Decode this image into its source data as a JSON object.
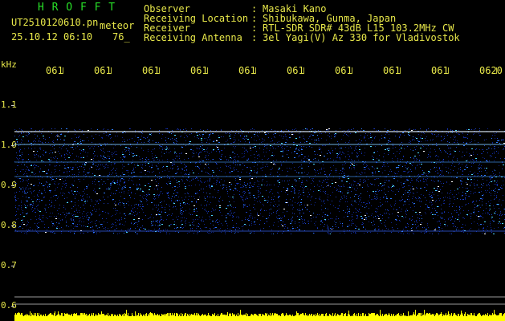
{
  "header": {
    "title": "H R O F F T",
    "file_name": "UT2510120610.pn",
    "type_label": "meteor",
    "date_time": "25.10.12 06:10",
    "count": "76_",
    "info_rows": [
      {
        "label": "Observer",
        "sep": ":",
        "value": "Masaki Kano"
      },
      {
        "label": "Receiving Location",
        "sep": ":",
        "value": "Shibukawa, Gunma, Japan"
      },
      {
        "label": "Receiver",
        "sep": ":",
        "value": "RTL-SDR SDR# 43dB L15 103.2MHz CW"
      },
      {
        "label": "Receiving Antenna",
        "sep": ":",
        "value": "3el Yagi(V) Az 330 for Vladivostok"
      }
    ]
  },
  "axes": {
    "y_unit": "kHz",
    "y_ticks": [
      "1.1",
      "1.0",
      "0.9",
      "0.8",
      "0.7",
      "0.6"
    ],
    "x_ticks": [
      "061",
      "061",
      "061",
      "061",
      "061",
      "061",
      "061",
      "061",
      "061",
      "0620"
    ]
  },
  "colors": {
    "header_text": "#e8e84a",
    "title_text": "#28e028",
    "background": "#000000",
    "noise": "#1a3aa8",
    "signal": "#ffffff",
    "power_bar": "#ffff00"
  }
}
